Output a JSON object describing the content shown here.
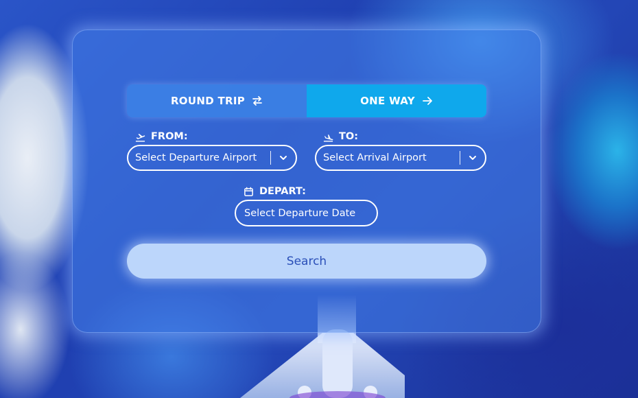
{
  "trip_type": {
    "round_trip_label": "ROUND TRIP",
    "one_way_label": "ONE WAY",
    "selected": "one_way"
  },
  "from": {
    "label": "FROM:",
    "placeholder": "Select Departure Airport"
  },
  "to": {
    "label": "TO:",
    "placeholder": "Select Arrival Airport"
  },
  "depart": {
    "label": "DEPART:",
    "placeholder": "Select Departure Date"
  },
  "search": {
    "label": "Search"
  },
  "colors": {
    "accent": "#0fa8ec",
    "search_bg": "#bcd6fb",
    "search_text": "#2a4fb8"
  },
  "icons": {
    "round_trip": "swap-arrows-icon",
    "one_way": "arrow-right-icon",
    "from": "plane-takeoff-icon",
    "to": "plane-landing-icon",
    "depart": "calendar-icon",
    "dropdown": "chevron-down-icon"
  }
}
